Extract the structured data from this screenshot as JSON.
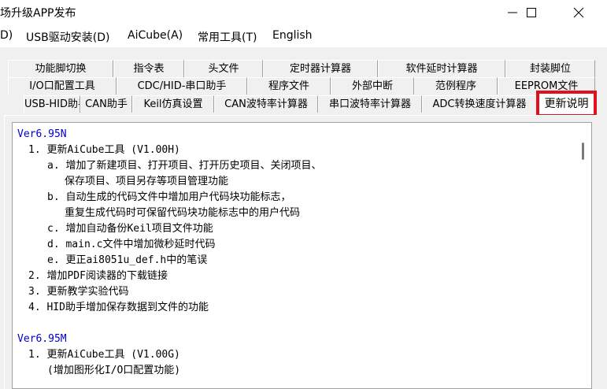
{
  "window": {
    "title": "场升级APP发布",
    "controls": [
      "minimize",
      "maximize",
      "close"
    ]
  },
  "menu": {
    "items": [
      "D)",
      "USB驱动安装(D)",
      "AiCube(A)",
      "常用工具(T)",
      "English"
    ]
  },
  "tabs": {
    "row1": [
      "功能脚切换",
      "指令表",
      "头文件",
      "定时器计算器",
      "软件延时计算器",
      "封装脚位"
    ],
    "row2": [
      "I/O口配置工具",
      "CDC/HID-串口助手",
      "程序文件",
      "外部中断",
      "范例程序",
      "EEPROM文件"
    ],
    "row3": [
      "USB-HID助手",
      "CAN助手",
      "Keil仿真设置",
      "CAN波特率计算器",
      "串口波特率计算器",
      "ADC转换速度计算器",
      "更新说明"
    ],
    "active": "更新说明"
  },
  "changelog": {
    "lines": [
      {
        "text": "Ver6.95N",
        "version": true
      },
      {
        "text": "1. 更新AiCube工具 (V1.00H)"
      },
      {
        "text": "a. 增加了新建项目、打开项目、打开历史项目、关闭项目、"
      },
      {
        "text": "保存项目、项目另存等项目管理功能"
      },
      {
        "text": "b. 自动生成的代码文件中增加用户代码块功能标志，"
      },
      {
        "text": "重复生成代码时可保留代码块功能标志中的用户代码"
      },
      {
        "text": "c. 增加自动备份Keil项目文件功能"
      },
      {
        "text": "d. main.c文件中增加微秒延时代码"
      },
      {
        "text": "e. 更正ai8051u_def.h中的笔误"
      },
      {
        "text": "2. 增加PDF阅读器的下载链接"
      },
      {
        "text": "3. 更新教学实验代码"
      },
      {
        "text": "4. HID助手增加保存数据到文件的功能"
      },
      {
        "text": "Ver6.95M",
        "version": true
      },
      {
        "text": "1. 更新AiCube工具 (V1.00G)"
      },
      {
        "text": "(增加图形化I/O口配置功能)"
      }
    ]
  },
  "colors": {
    "version_text": "#0000c8",
    "active_tab_highlight": "#e01020"
  }
}
